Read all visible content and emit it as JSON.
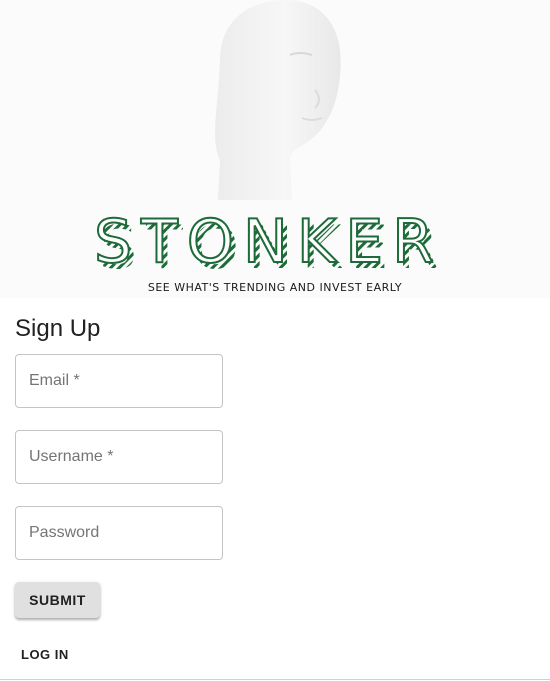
{
  "banner": {
    "logo_text": "STONKER",
    "tagline": "SEE WHAT'S TRENDING AND INVEST EARLY",
    "brand_color": "#1e6b3a",
    "icon": "stonks-bust-image"
  },
  "form": {
    "title": "Sign Up",
    "email_placeholder": "Email *",
    "username_placeholder": "Username *",
    "password_placeholder": "Password",
    "submit_label": "SUBMIT",
    "login_label": "LOG IN"
  }
}
